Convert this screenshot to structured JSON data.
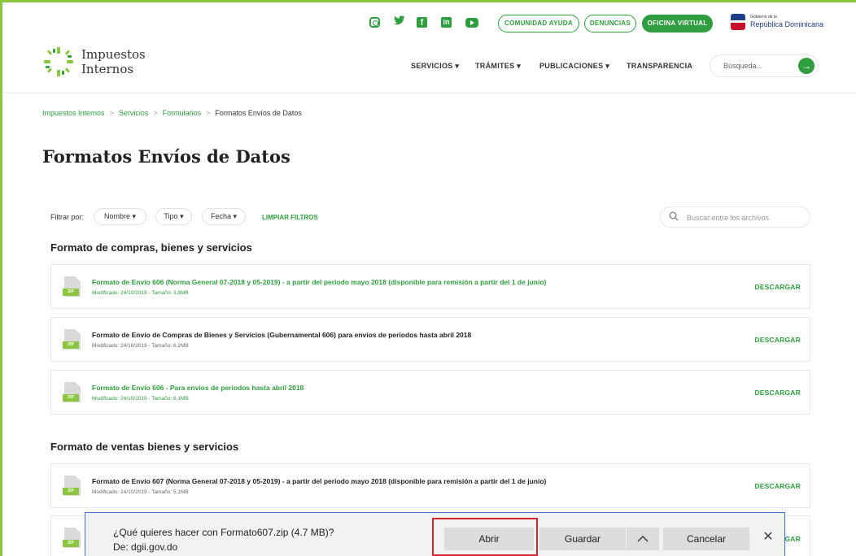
{
  "topbar": {
    "social_icons": [
      "instagram-icon",
      "twitter-icon",
      "facebook-icon",
      "linkedin-icon",
      "youtube-icon"
    ],
    "links": {
      "comunidad": "COMUNIDAD AYUDA",
      "denuncias": "DENUNCIAS",
      "oficina": "OFICINA VIRTUAL"
    },
    "gov_small": "Gobierno de la",
    "gov_name": "República Dominicana"
  },
  "header": {
    "logo_line1": "Impuestos",
    "logo_line2": "Internos",
    "nav": {
      "servicios": "SERVICIOS ▾",
      "tramites": "TRÁMITES ▾",
      "publicaciones": "PUBLICACIONES ▾",
      "transparencia": "TRANSPARENCIA"
    },
    "search_placeholder": "Búsqueda..."
  },
  "breadcrumb": {
    "c1": "Impuestos Internos",
    "c2": "Servicios",
    "c3": "Formularios",
    "current": "Formatos Envíos de Datos",
    "sep": ">"
  },
  "page": {
    "title": "Formatos Envíos de Datos"
  },
  "filters": {
    "label": "Filtrar por:",
    "nombre": "Nombre ▾",
    "tipo": "Tipo ▾",
    "fecha": "Fecha ▾",
    "limpiar": "LIMPIAR FILTROS",
    "file_search_placeholder": "Buscar entre los archivos"
  },
  "sections": {
    "compras": {
      "title": "Formato de compras, bienes y servicios",
      "items": [
        {
          "title": "Formato de Envío 606 (Norma General 07-2018 y 05-2019) - a partir del periodo mayo 2018 (disponible para remisión a partir del 1 de junio)",
          "meta": "Modificado: 24/10/2019 - Tamaño: 3,8MB",
          "action": "DESCARGAR"
        },
        {
          "title": "Formato de Envío de Compras de Bienes y Servicios (Gubernamental 606) para envíos de periodos hasta abril 2018",
          "meta": "Modificado: 24/10/2019 - Tamaño: 6,2MB",
          "action": "DESCARGAR"
        },
        {
          "title": "Formato de Envío 606 - Para envíos de periodos hasta abril 2018",
          "meta": "Modificado: 24/10/2019 - Tamaño: 6,1MB",
          "action": "DESCARGAR"
        }
      ]
    },
    "ventas": {
      "title": "Formato de ventas bienes y servicios",
      "items": [
        {
          "title": "Formato de Envío 607 (Norma General 07-2018 y 05-2019) - a partir del periodo mayo 2018 (disponible para remisión a partir del 1 de junio)",
          "meta": "Modificado: 24/10/2019 - Tamaño: 5,1MB",
          "action": "DESCARGAR"
        },
        {
          "action_partial": "GAR"
        }
      ]
    }
  },
  "zip_label": "ZIP",
  "download_bar": {
    "question": "¿Qué quieres hacer con Formato607.zip (4.7 MB)?",
    "from": "De: dgii.gov.do",
    "open": "Abrir",
    "save": "Guardar",
    "cancel": "Cancelar"
  }
}
